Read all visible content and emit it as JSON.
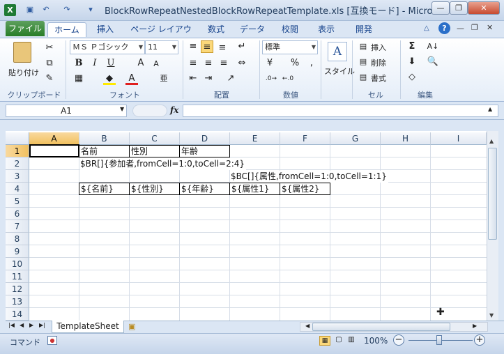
{
  "titlebar": {
    "title": "BlockRowRepeatNestedBlockRowRepeatTemplate.xls  [互換モード] - Micros..."
  },
  "tabs": [
    "ファイル",
    "ホーム",
    "挿入",
    "ページ レイアウト",
    "数式",
    "データ",
    "校閲",
    "表示",
    "開発"
  ],
  "ribbon": {
    "paste": "貼り付け",
    "font_name": "ＭＳ Ｐゴシック",
    "font_size": "11",
    "number_format": "標準",
    "style": "スタイル",
    "insert": "挿入",
    "delete": "削除",
    "format": "書式",
    "groups": {
      "clipboard": "クリップボード",
      "font": "フォント",
      "alignment": "配置",
      "number": "数値",
      "cells": "セル",
      "editing": "編集"
    }
  },
  "formula": {
    "namebox": "A1",
    "fx": "fx",
    "content": ""
  },
  "columns": [
    "A",
    "B",
    "C",
    "D",
    "E",
    "F",
    "G",
    "H",
    "I"
  ],
  "rows": [
    "1",
    "2",
    "3",
    "4",
    "5",
    "6",
    "7",
    "8",
    "9",
    "10",
    "11",
    "12",
    "13",
    "14"
  ],
  "cells": {
    "b1": "名前",
    "c1": "性別",
    "d1": "年齢",
    "b2": "$BR[]{参加者,fromCell=1:0,toCell=2:4}",
    "e3": "$BC[]{属性,fromCell=1:0,toCell=1:1}",
    "b4": "${名前}",
    "c4": "${性別}",
    "d4": "${年齢}",
    "e4": "${属性1}",
    "f4": "${属性2}"
  },
  "sheet_tab": "TemplateSheet",
  "status": {
    "mode": "コマンド",
    "zoom": "100%"
  }
}
